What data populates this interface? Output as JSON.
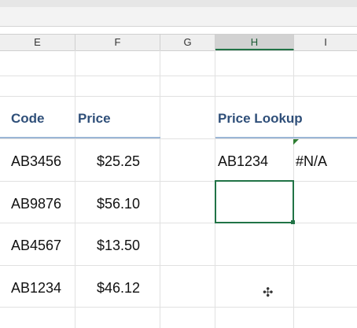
{
  "columns": [
    "E",
    "F",
    "G",
    "H",
    "I"
  ],
  "selected_column": "H",
  "table": {
    "headers": {
      "code": "Code",
      "price": "Price"
    },
    "rows": [
      {
        "code": "AB3456",
        "price": "$25.25"
      },
      {
        "code": "AB9876",
        "price": "$56.10"
      },
      {
        "code": "AB4567",
        "price": "$13.50"
      },
      {
        "code": "AB1234",
        "price": "$46.12"
      }
    ]
  },
  "lookup": {
    "header": "Price Lookup",
    "input_code": "AB1234",
    "result": "#N/A"
  },
  "colors": {
    "header_text": "#2f4f79",
    "selection": "#217346"
  }
}
